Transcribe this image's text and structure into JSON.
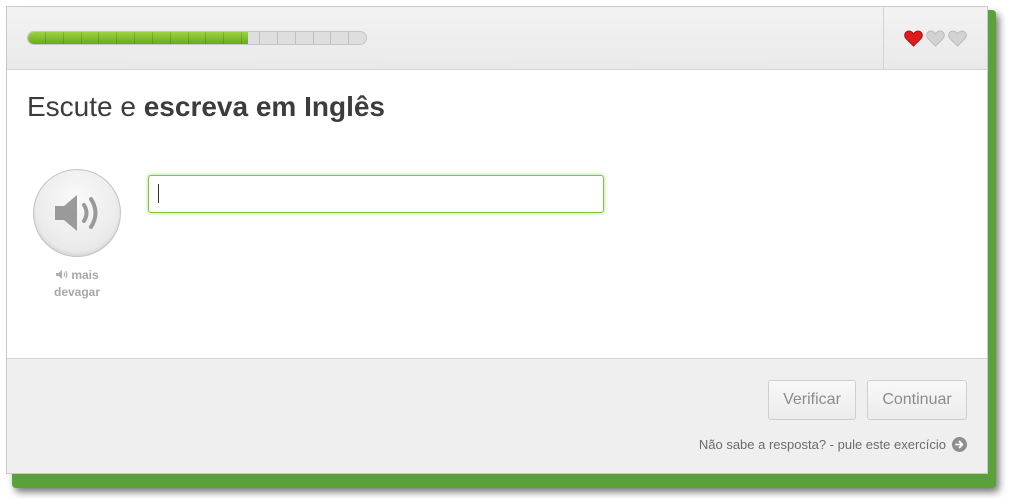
{
  "progress": {
    "fraction": 0.65,
    "segments": 19
  },
  "hearts": [
    {
      "state": "full",
      "color": "#e01b1b",
      "icon": "heart-full-icon"
    },
    {
      "state": "empty",
      "color": "#d2d2d2",
      "icon": "heart-empty-icon"
    },
    {
      "state": "empty",
      "color": "#d2d2d2",
      "icon": "heart-empty-icon"
    }
  ],
  "exercise": {
    "title_prefix": "Escute e ",
    "title_bold": "escreva em Inglês",
    "slower_label_line1": "mais",
    "slower_label_line2": "devagar",
    "answer_value": "",
    "answer_placeholder": ""
  },
  "footer": {
    "verify_label": "Verificar",
    "continue_label": "Continuar",
    "skip_text": "Não sabe a resposta? - pule este exercício"
  },
  "colors": {
    "accent_green": "#7dc83c",
    "progress_green": "#78b528"
  }
}
